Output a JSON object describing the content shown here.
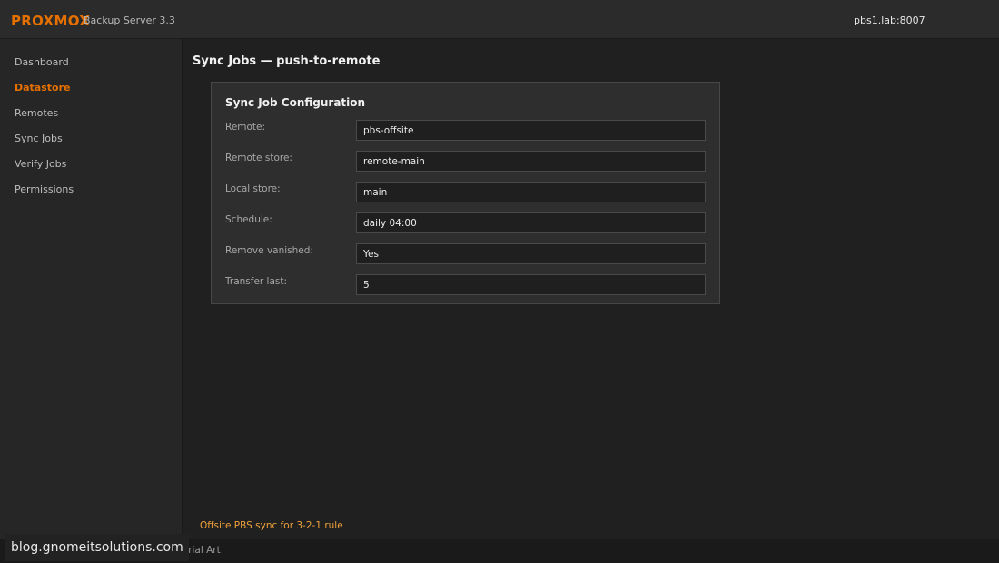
{
  "header": {
    "brand": "PROXMOX",
    "product": "Backup Server 3.3",
    "host": "pbs1.lab:8007"
  },
  "sidebar": {
    "items": [
      {
        "label": "Dashboard",
        "active": false
      },
      {
        "label": "Datastore",
        "active": true
      },
      {
        "label": "Remotes",
        "active": false
      },
      {
        "label": "Sync Jobs",
        "active": false
      },
      {
        "label": "Verify Jobs",
        "active": false
      },
      {
        "label": "Permissions",
        "active": false
      }
    ]
  },
  "main": {
    "title": "Sync Jobs — push-to-remote",
    "panel": {
      "title": "Sync Job Configuration",
      "fields": [
        {
          "label": "Remote:",
          "value": "pbs-offsite"
        },
        {
          "label": "Remote store:",
          "value": "remote-main"
        },
        {
          "label": "Local store:",
          "value": "main"
        },
        {
          "label": "Schedule:",
          "value": "daily 04:00"
        },
        {
          "label": "Remove vanished:",
          "value": "Yes"
        },
        {
          "label": "Transfer last:",
          "value": "5"
        }
      ]
    },
    "note": "Offsite PBS sync for 3-2-1 rule"
  },
  "footer": {
    "text": "utorial Art",
    "watermark": "blog.gnomeitsolutions.com"
  },
  "colors": {
    "accent": "#e57000",
    "note": "#f0a23a"
  }
}
